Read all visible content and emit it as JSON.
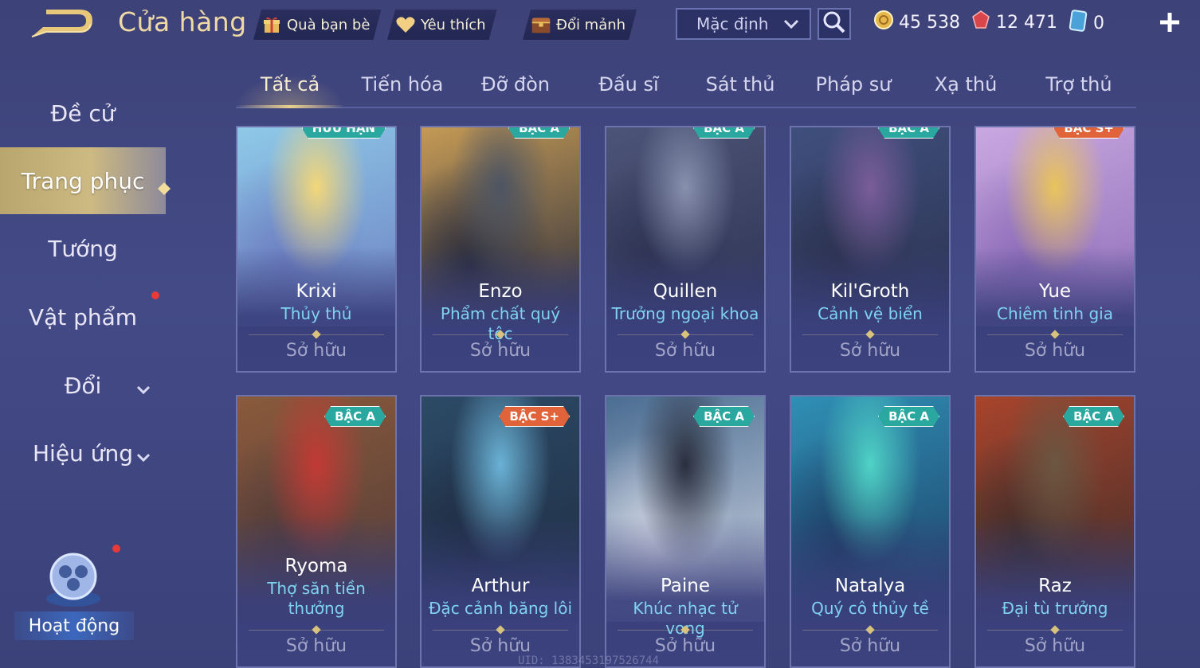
{
  "header": {
    "title": "Cửa hàng",
    "buttons": [
      {
        "label": "Quà bạn bè",
        "icon": "gift-icon"
      },
      {
        "label": "Yêu thích",
        "icon": "heart-icon"
      },
      {
        "label": "Đổi mảnh",
        "icon": "chest-icon"
      }
    ],
    "sort": {
      "value": "Mặc định"
    },
    "currency": [
      {
        "icon": "gold-coin-icon",
        "value": "45 538"
      },
      {
        "icon": "red-gem-icon",
        "value": "12 471"
      },
      {
        "icon": "blue-card-icon",
        "value": "0"
      }
    ]
  },
  "sidebar": {
    "items": [
      {
        "label": "Đề cử"
      },
      {
        "label": "Trang phục"
      },
      {
        "label": "Tướng"
      },
      {
        "label": "Vật phẩm"
      },
      {
        "label": "Đổi"
      },
      {
        "label": "Hiệu ứng"
      }
    ],
    "activity_label": "Hoạt động"
  },
  "tabs": [
    "Tất cả",
    "Tiến hóa",
    "Đỡ đòn",
    "Đấu sĩ",
    "Sát thủ",
    "Pháp sư",
    "Xạ thủ",
    "Trợ thủ"
  ],
  "cards": [
    {
      "name": "Krixi",
      "skin": "Thủy thủ",
      "status": "Sở hữu",
      "badge": "HỮU HẠN",
      "colors": [
        "#8ec9e8",
        "#f2d77a",
        "#6d7fc2"
      ]
    },
    {
      "name": "Enzo",
      "skin": "Phẩm chất quý tộc",
      "status": "Sở hữu",
      "badge": "BẬC A",
      "colors": [
        "#c49a55",
        "#4d5563",
        "#2b2d3d"
      ]
    },
    {
      "name": "Quillen",
      "skin": "Trưởng ngoại khoa",
      "status": "Sở hữu",
      "badge": "BẬC A",
      "colors": [
        "#4c5478",
        "#8790ad",
        "#2e3352"
      ]
    },
    {
      "name": "Kil'Groth",
      "skin": "Cảnh vệ biển",
      "status": "Sở hữu",
      "badge": "BẬC A",
      "colors": [
        "#3f4f7d",
        "#7a5d9a",
        "#2c3250"
      ]
    },
    {
      "name": "Yue",
      "skin": "Chiêm tinh gia",
      "status": "Sở hữu",
      "badge": "BẬC S+",
      "colors": [
        "#c9a7e0",
        "#e9c45c",
        "#8d6db8"
      ]
    },
    {
      "name": "Ryoma",
      "skin": "Thợ săn tiền thưởng",
      "status": "Sở hữu",
      "badge": "BẬC A",
      "colors": [
        "#8a5a3b",
        "#c23a35",
        "#4f3a3a"
      ]
    },
    {
      "name": "Arthur",
      "skin": "Đặc cảnh băng lôi",
      "status": "Sở hữu",
      "badge": "BẬC S+",
      "colors": [
        "#2c4a66",
        "#6ab2d6",
        "#1f2c42"
      ]
    },
    {
      "name": "Paine",
      "skin": "Khúc nhạc tử vong",
      "status": "Sở hữu",
      "badge": "BẬC A",
      "colors": [
        "#4a6d92",
        "#2a2f3e",
        "#d3d7e4"
      ]
    },
    {
      "name": "Natalya",
      "skin": "Quý cô thủy tề",
      "status": "Sở hữu",
      "badge": "BẬC A",
      "colors": [
        "#2f8fb5",
        "#4fd3c6",
        "#1d3d64"
      ]
    },
    {
      "name": "Raz",
      "skin": "Đại tù trưởng",
      "status": "Sở hữu",
      "badge": "BẬC A",
      "colors": [
        "#a8442c",
        "#6b5642",
        "#3a2c2a"
      ]
    }
  ],
  "badge_colors": {
    "BẬC A": "#2aa8a0",
    "BẬC S+": "#e0633a",
    "HỮU HẠN": "#2aa8a0"
  },
  "uid": "UID: 1383453197526744"
}
